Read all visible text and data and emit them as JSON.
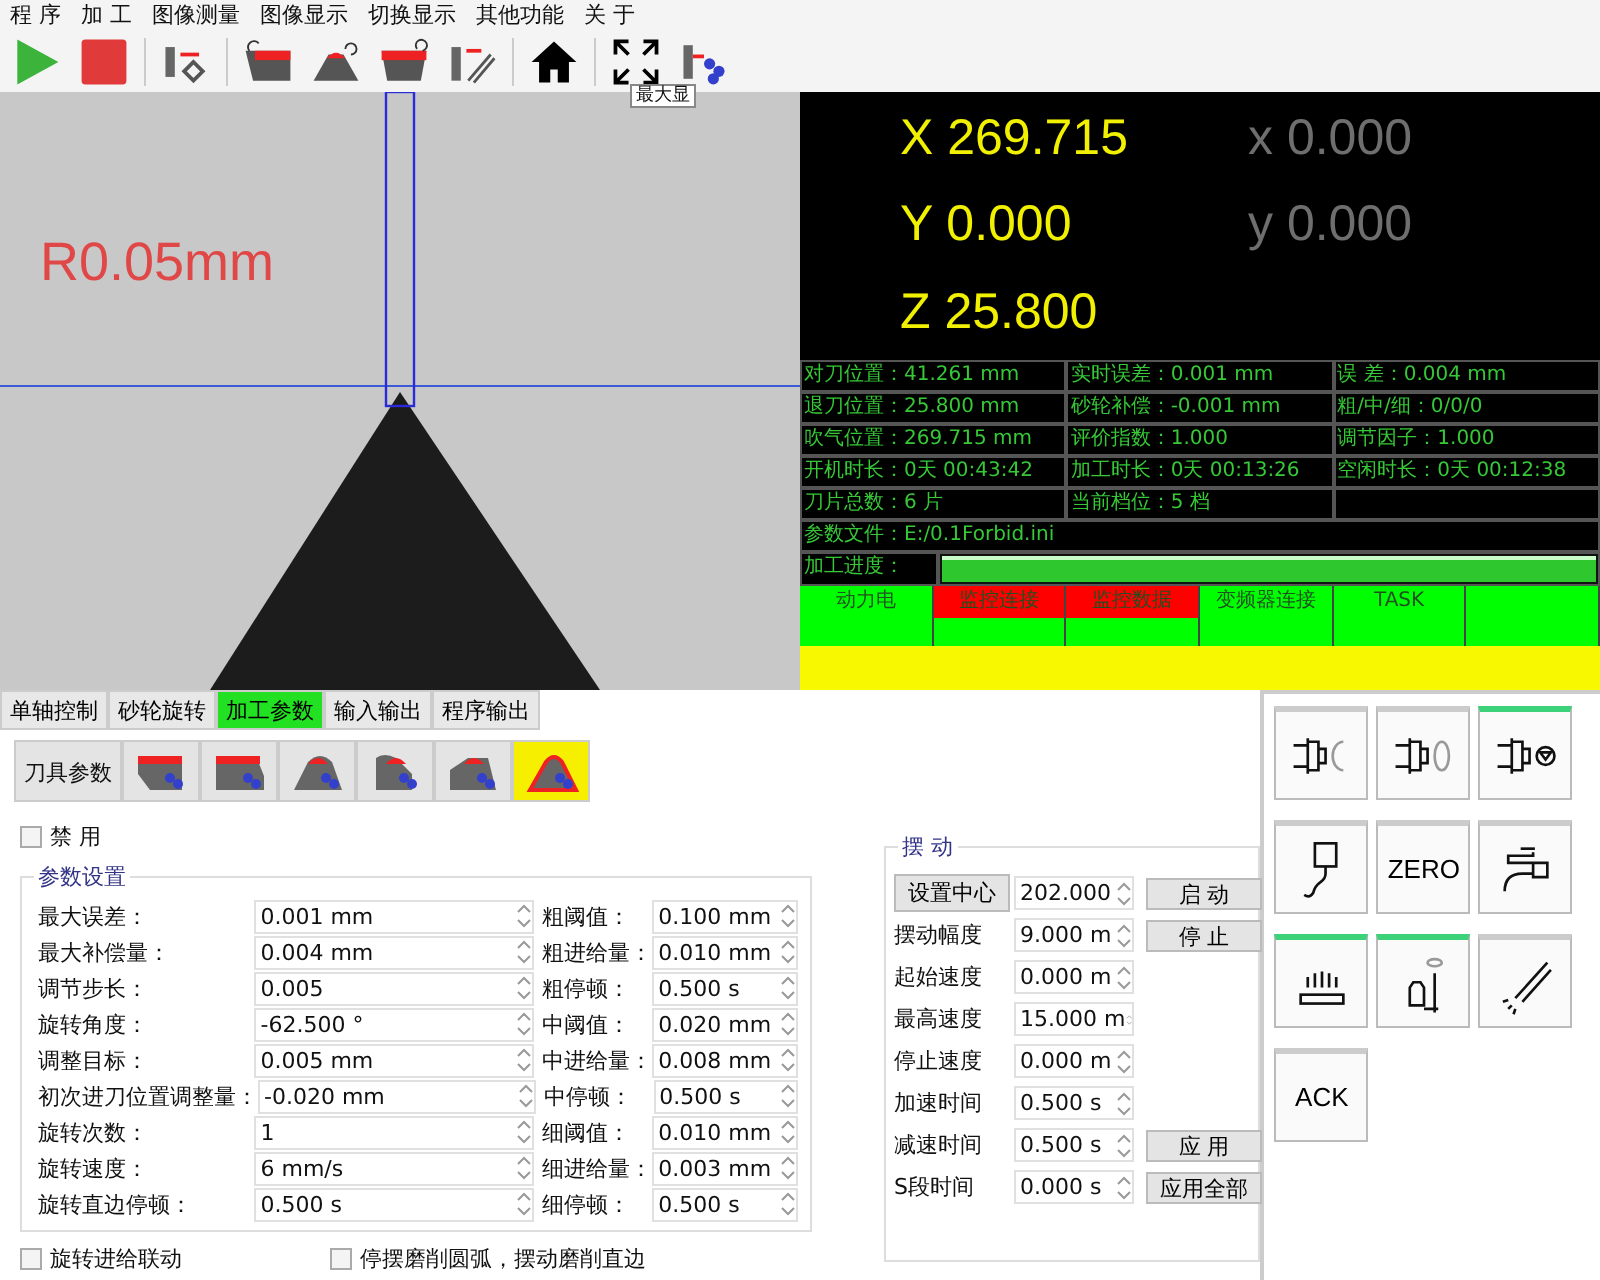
{
  "menu": [
    "程 序",
    "加 工",
    "图像测量",
    "图像显示",
    "切换显示",
    "其他功能",
    "关 于"
  ],
  "toolbar": [
    {
      "kind": "play"
    },
    {
      "kind": "stop"
    },
    {
      "kind": "probe"
    },
    {
      "kind": "wheel-flat"
    },
    {
      "kind": "wheel-arc"
    },
    {
      "kind": "wheel-cup"
    },
    {
      "kind": "dresser"
    },
    {
      "kind": "home"
    },
    {
      "kind": "fullscreen"
    },
    {
      "kind": "tool"
    }
  ],
  "tooltip": "最大显",
  "camera": {
    "label": "R0.05mm"
  },
  "coordinates": [
    {
      "machine": "X 269.715",
      "relative": "x 0.000"
    },
    {
      "machine": "Y 0.000",
      "relative": "y 0.000"
    },
    {
      "machine": "Z 25.800"
    }
  ],
  "info": [
    [
      "对刀位置：41.261 mm",
      "实时误差：0.001 mm",
      "误 差：0.004 mm"
    ],
    [
      "退刀位置：25.800 mm",
      "砂轮补偿：-0.001 mm",
      "粗/中/细：0/0/0"
    ],
    [
      "吹气位置：269.715 mm",
      "评价指数：1.000",
      "调节因子：1.000"
    ],
    [
      "开机时长：0天  00:43:42",
      "加工时长：0天  00:13:26",
      "空闲时长：0天  00:12:38"
    ],
    [
      "刀片总数：6 片",
      "当前档位：5 档"
    ]
  ],
  "param_file": "参数文件：E:/0.1Forbid.ini",
  "progress": {
    "label": "加工进度：",
    "level": 1
  },
  "status": [
    {
      "label": "动力电",
      "color": "#00ff00"
    },
    {
      "label": "监控连接",
      "color": "#ff0000"
    },
    {
      "label": "监控数据",
      "color": "#ff0000"
    },
    {
      "label": "变频器连接",
      "color": "#00ff00"
    },
    {
      "label": "TASK",
      "color": "#00ff00"
    },
    {
      "color": "#00ff00"
    }
  ],
  "indicators": [
    {
      "color": "#00ff00"
    },
    {
      "color": "#00ff00"
    },
    {
      "color": "#00ff00"
    },
    {
      "color": "#00ff00"
    },
    {
      "color": "#00ff00"
    },
    {
      "color": "#00ff00"
    }
  ],
  "tabs": [
    {
      "label": "单轴控制",
      "selected": false
    },
    {
      "label": "砂轮旋转",
      "selected": false
    },
    {
      "label": "加工参数",
      "selected": true
    },
    {
      "label": "输入输出",
      "selected": false
    },
    {
      "label": "程序输出",
      "selected": false
    }
  ],
  "tool_tabs": {
    "label": "刀具参数",
    "items": [
      {
        "kind": "flat",
        "selected": false
      },
      {
        "kind": "flat-step",
        "selected": false
      },
      {
        "kind": "arc",
        "selected": false
      },
      {
        "kind": "corner",
        "selected": false
      },
      {
        "kind": "bevel",
        "selected": false
      },
      {
        "kind": "round",
        "selected": true
      }
    ]
  },
  "disable": {
    "label": "禁 用",
    "checked": false
  },
  "params": {
    "title": "参数设置",
    "rows": [
      {
        "label": "最大误差：",
        "value": "0.001 mm",
        "label_2": "粗阈值：",
        "value_2": "0.100 mm"
      },
      {
        "label": "最大补偿量：",
        "value": "0.004 mm",
        "label_2": "粗进给量：",
        "value_2": "0.010 mm"
      },
      {
        "label": "调节步长：",
        "value": "0.005",
        "label_2": "粗停顿：",
        "value_2": "0.500 s"
      },
      {
        "label": "旋转角度：",
        "value": "-62.500 °",
        "label_2": "中阈值：",
        "value_2": "0.020 mm"
      },
      {
        "label": "调整目标：",
        "value": "0.005 mm",
        "label_2": "中进给量：",
        "value_2": "0.008 mm"
      },
      {
        "label": "初次进刀位置调整量：",
        "value": "-0.020 mm",
        "label_2": "中停顿：",
        "value_2": "0.500 s"
      },
      {
        "label": "旋转次数：",
        "value": "1",
        "label_2": "细阈值：",
        "value_2": "0.010 mm"
      },
      {
        "label": "旋转速度：",
        "value": "6 mm/s",
        "label_2": "细进给量：",
        "value_2": "0.003 mm"
      },
      {
        "label": "旋转直边停顿：",
        "value": "0.500 s",
        "label_2": "细停顿：",
        "value_2": "0.500 s"
      }
    ],
    "options": [
      {
        "label": "旋转进给联动",
        "checked": false
      },
      {
        "label": "停摆磨削圆弧，摆动磨削直边",
        "checked": false
      }
    ]
  },
  "swing": {
    "title": "摆 动",
    "rows": [
      {
        "label": "设置中心",
        "kind": "button",
        "value": "202.000",
        "action": "启 动"
      },
      {
        "label": "摆动幅度",
        "kind": "text",
        "value": "9.000 m",
        "action": "停 止"
      },
      {
        "label": "起始速度",
        "kind": "text",
        "value": "0.000 m"
      },
      {
        "label": "最高速度",
        "kind": "text",
        "value": "15.000 m"
      },
      {
        "label": "停止速度",
        "kind": "text",
        "value": "0.000 m"
      },
      {
        "label": "加速时间",
        "kind": "text",
        "value": "0.500 s"
      },
      {
        "label": "减速时间",
        "kind": "text",
        "value": "0.500 s",
        "action": "应 用"
      },
      {
        "label": "S段时间",
        "kind": "text",
        "value": "0.000 s",
        "action": "应用全部"
      }
    ]
  },
  "panel_buttons": [
    {
      "kind": "clamp-arc",
      "on": false
    },
    {
      "kind": "clamp-oval",
      "on": false
    },
    {
      "kind": "clamp-diamond",
      "on": true
    },
    {
      "kind": "hook",
      "on": false
    },
    {
      "kind": "text",
      "label": "ZERO",
      "on": false
    },
    {
      "kind": "tap",
      "on": false
    },
    {
      "kind": "lamp",
      "on": true
    },
    {
      "kind": "pump",
      "on": true
    },
    {
      "kind": "nozzle",
      "on": false
    },
    {
      "kind": "text",
      "label": "ACK",
      "on": false
    }
  ]
}
